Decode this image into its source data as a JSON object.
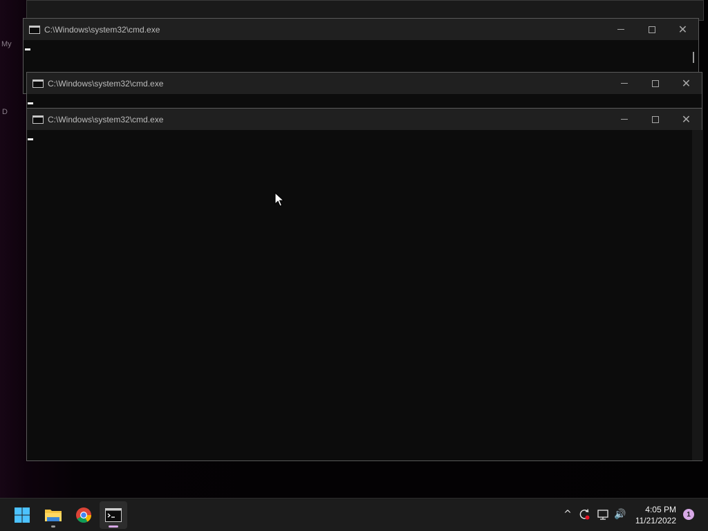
{
  "desktop": {
    "fragments": [
      "My",
      "D"
    ]
  },
  "windows": [
    {
      "title": "C:\\Windows\\system32\\cmd.exe",
      "state": "background"
    },
    {
      "title": "C:\\Windows\\system32\\cmd.exe",
      "state": "background"
    },
    {
      "title": "C:\\Windows\\system32\\cmd.exe",
      "state": "active"
    }
  ],
  "window_controls": {
    "minimize": "minimize-icon",
    "maximize": "maximize-icon",
    "close": "close-icon",
    "close_glyph": "✕"
  },
  "taskbar": {
    "apps": [
      {
        "name": "Start",
        "icon": "windows-logo-icon"
      },
      {
        "name": "File Explorer",
        "icon": "folder-icon",
        "running": true
      },
      {
        "name": "Google Chrome",
        "icon": "chrome-icon"
      },
      {
        "name": "Command Prompt",
        "icon": "cmd-icon",
        "running": true,
        "active": true
      }
    ],
    "tray": {
      "overflow_glyph": "^",
      "icons": [
        "chevron-up-icon",
        "sync-icon",
        "network-icon",
        "volume-icon"
      ],
      "volume_glyph": "🔊",
      "time": "4:05 PM",
      "date": "11/21/2022",
      "notification_count": "1"
    },
    "colors": {
      "accent": "#d7a8e6",
      "windows_blue": "#4cc2ff",
      "folder_yellow": "#f4c542"
    }
  }
}
